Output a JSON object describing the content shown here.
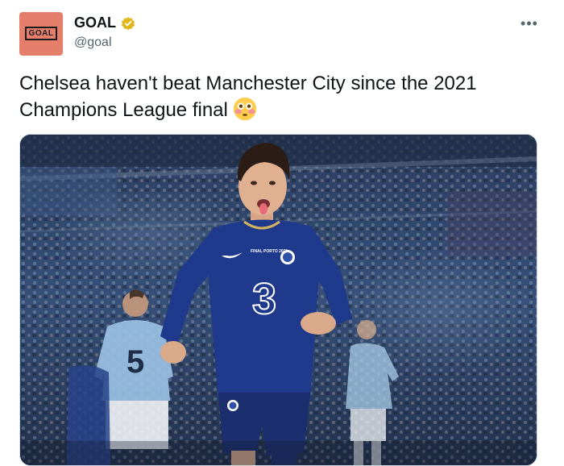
{
  "account": {
    "display_name": "GOAL",
    "handle": "@goal",
    "avatar_text": "GOAL"
  },
  "tweet": {
    "text": "Chelsea haven't beat Manchester City since the 2021 Champions League final",
    "emoji": "flushed-face"
  },
  "media": {
    "kit_text": "FINAL PORTO 2021",
    "sponsor_number": "3",
    "opponent_number": "5"
  },
  "colors": {
    "avatar_bg": "#e57f6b",
    "verified_gold": "#e2b719",
    "chelsea_blue": "#1f3a8c",
    "city_blue": "#9cc3e6"
  }
}
